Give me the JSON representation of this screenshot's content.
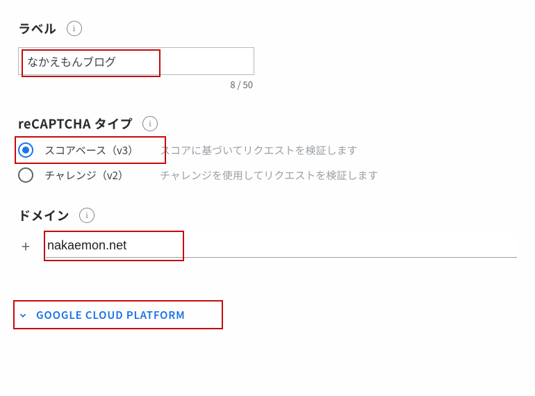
{
  "label_section": {
    "title": "ラベル",
    "value": "なかえもんブログ",
    "char_count": "8 / 50"
  },
  "type_section": {
    "title": "reCAPTCHA タイプ",
    "options": [
      {
        "label": "スコアベース（v3）",
        "desc": "スコアに基づいてリクエストを検証します",
        "selected": true
      },
      {
        "label": "チャレンジ（v2）",
        "desc": "チャレンジを使用してリクエストを検証します",
        "selected": false
      }
    ]
  },
  "domain_section": {
    "title": "ドメイン",
    "value": "nakaemon.net"
  },
  "collapsible": {
    "label": "GOOGLE CLOUD PLATFORM"
  }
}
